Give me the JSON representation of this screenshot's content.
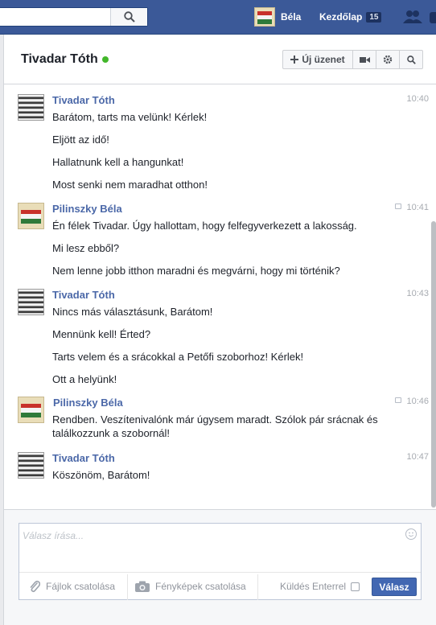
{
  "topbar": {
    "search_placeholder": "",
    "user_name": "Béla",
    "home_label": "Kezdőlap",
    "home_count": "15"
  },
  "header": {
    "title": "Tivadar Tóth",
    "new_message_label": "Új üzenet"
  },
  "messages": [
    {
      "sender": "Tivadar Tóth",
      "time": "10:40",
      "avatar": "photo",
      "lines": [
        "Barátom, tarts ma velünk! Kérlek!",
        "Eljött az idő!",
        "Hallatnunk kell a hangunkat!",
        "Most senki nem maradhat otthon!"
      ]
    },
    {
      "sender": "Pilinszky Béla",
      "time": "10:41",
      "avatar": "flag",
      "lines": [
        "Én félek Tivadar. Úgy hallottam, hogy felfegyverkezett a lakosság.",
        "Mi lesz ebből?",
        "Nem lenne jobb itthon maradni és megvárni, hogy mi történik?"
      ]
    },
    {
      "sender": "Tivadar Tóth",
      "time": "10:43",
      "avatar": "photo",
      "lines": [
        "Nincs más választásunk, Barátom!",
        "Mennünk kell! Érted?",
        "Tarts velem és a srácokkal a Petőfi szoborhoz! Kérlek!",
        "Ott a helyünk!"
      ]
    },
    {
      "sender": "Pilinszky Béla",
      "time": "10:46",
      "avatar": "flag",
      "lines": [
        "Rendben. Veszítenivalónk már úgysem maradt. Szólok pár srácnak és találkozzunk a szobornál!"
      ]
    },
    {
      "sender": "Tivadar Tóth",
      "time": "10:47",
      "avatar": "photo",
      "lines": [
        "Köszönöm, Barátom!"
      ]
    }
  ],
  "composer": {
    "placeholder": "Válasz írása...",
    "attach_files_label": "Fájlok csatolása",
    "attach_photos_label": "Fényképek csatolása",
    "send_on_enter_label": "Küldés Enterrel",
    "send_on_enter_checked": false,
    "reply_button_label": "Válasz"
  },
  "colors": {
    "topbar": "#3b5998",
    "sender_link": "#4b68a8",
    "online": "#42b72a",
    "primary_button": "#4267b2"
  },
  "icons": [
    "search-icon",
    "friends-icon",
    "messages-icon",
    "plus-icon",
    "video-icon",
    "gear-icon",
    "search-icon",
    "message-bubble-icon",
    "smiley-icon",
    "paperclip-icon",
    "camera-icon"
  ]
}
